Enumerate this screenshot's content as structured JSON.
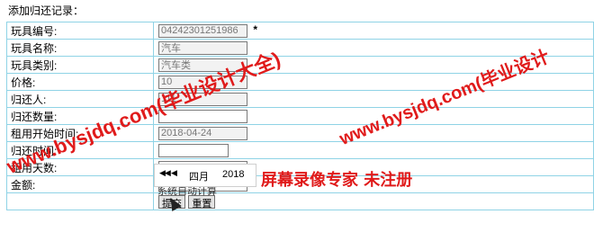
{
  "page": {
    "title": "添加归还记录："
  },
  "form": {
    "rows": [
      {
        "label": "玩具编号:",
        "value": "04242301251986",
        "readonly": true,
        "required": true
      },
      {
        "label": "玩具名称:",
        "value": "汽车",
        "readonly": true
      },
      {
        "label": "玩具类别:",
        "value": "汽车类",
        "readonly": true
      },
      {
        "label": "价格:",
        "value": "10",
        "readonly": true
      },
      {
        "label": "归还人:",
        "value": "111",
        "readonly": true
      },
      {
        "label": "归还数量:",
        "value": ""
      },
      {
        "label": "租用开始时间:",
        "value": "2018-04-24",
        "readonly": true
      },
      {
        "label": "归还时间:",
        "value": ""
      },
      {
        "label": "租用天数:",
        "value": ""
      },
      {
        "label": "金额:",
        "value": ""
      }
    ],
    "required_mark": "*",
    "amount_hint": "系统自动计算",
    "submit_label": "提交",
    "reset_label": "重置"
  },
  "datepicker": {
    "prev_year": "◀◀",
    "prev_month": "◀",
    "month": "四月",
    "year": "2018"
  },
  "watermark": {
    "line1": "www.bysjdq.com(毕业设计大全)",
    "line2": "www.bysjdq.com(毕业设计",
    "line3": "屏幕录像专家 未注册"
  },
  "colors": {
    "table_border": "#8fd3e6",
    "watermark": "#e01b1b"
  }
}
